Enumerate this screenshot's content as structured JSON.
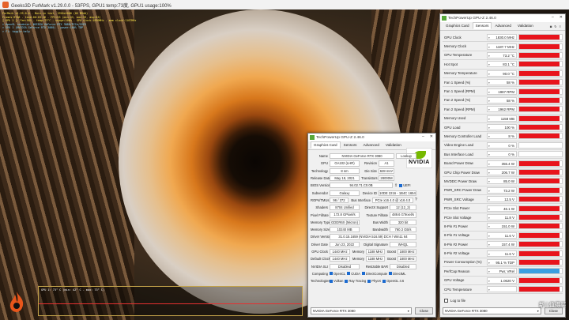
{
  "furmark": {
    "title": "Geeks3D FurMark v1.29.0.0 - 53FPS, GPU1 temp:73度, GPU1 usage:100%",
    "osd": [
      "FurMark v1.29.0.0 - Burn-in test, 1920x1080 (0X MSAA)",
      "Frames:9746 - time:00:03:16 - FPS:53 (min:43, max:59, avg:55)",
      "[ GPU 1 ]: Fan:56% - temp:73°C - usage:100% - GPU clock:1830MHz - mem clock:1187MHz",
      "> OpenGL renderer: NVIDIA GeForce RTX 3080/PCIe/SSE2",
      "> GPU 1 (NVIDIA GeForce RTX 3080) - power:100% TDP",
      "> F1: toggle help"
    ],
    "graph_label": "GPU 1: 73° C (min: 42° C - max: 73° C)"
  },
  "gpuz_sensors": {
    "title": "TechPowerUp GPU-Z 2.46.0",
    "tabs": [
      "Graphics Card",
      "Sensors",
      "Advanced",
      "Validation"
    ],
    "active_tab": "Sensors",
    "rows": [
      {
        "label": "GPU Clock",
        "value": "1830.0 MHz",
        "fill": 0.95
      },
      {
        "label": "Memory Clock",
        "value": "1187.7 MHz",
        "fill": 0.95
      },
      {
        "label": "GPU Temperature",
        "value": "73.2 °C",
        "fill": 0.95
      },
      {
        "label": "Hot Spot",
        "value": "83.1 °C",
        "fill": 0.95
      },
      {
        "label": "Memory Temperature",
        "value": "90.0 °C",
        "fill": 0.95
      },
      {
        "label": "Fan 1 Speed (%)",
        "value": "58 %",
        "fill": 0.95
      },
      {
        "label": "Fan 1 Speed (RPM)",
        "value": "1987 RPM",
        "fill": 0.95
      },
      {
        "label": "Fan 2 Speed (%)",
        "value": "58 %",
        "fill": 0.95
      },
      {
        "label": "Fan 2 Speed (RPM)",
        "value": "1962 RPM",
        "fill": 0.95
      },
      {
        "label": "Memory Used",
        "value": "1158 MB",
        "fill": 0.95
      },
      {
        "label": "GPU Load",
        "value": "100 %",
        "fill": 0.95
      },
      {
        "label": "Memory Controller Load",
        "value": "8 %",
        "fill": 0.95
      },
      {
        "label": "Video Engine Load",
        "value": "0 %",
        "fill": 0
      },
      {
        "label": "Bus Interface Load",
        "value": "0 %",
        "fill": 0
      },
      {
        "label": "Board Power Draw",
        "value": "355.4 W",
        "fill": 0.95
      },
      {
        "label": "GPU Chip Power Draw",
        "value": "206.7 W",
        "fill": 0.95
      },
      {
        "label": "MVDDC Power Draw",
        "value": "85.0 W",
        "fill": 0.95
      },
      {
        "label": "PWR_SRC Power Draw",
        "value": "73.2 W",
        "fill": 0.95
      },
      {
        "label": "PWR_SRC Voltage",
        "value": "12.5 V",
        "fill": 0.95
      },
      {
        "label": "PCIe Slot Power",
        "value": "46.1 W",
        "fill": 0.95
      },
      {
        "label": "PCIe Slot Voltage",
        "value": "11.8 V",
        "fill": 0.95
      },
      {
        "label": "8-Pin #1 Power",
        "value": "151.0 W",
        "fill": 0.95
      },
      {
        "label": "8-Pin #1 Voltage",
        "value": "11.6 V",
        "fill": 0.95
      },
      {
        "label": "8-Pin #2 Power",
        "value": "157.4 W",
        "fill": 0.95
      },
      {
        "label": "8-Pin #2 Voltage",
        "value": "11.6 V",
        "fill": 0.95
      },
      {
        "label": "Power Consumption (%)",
        "value": "95.1 % TDP",
        "fill": 0.95
      },
      {
        "label": "PerfCap Reason",
        "value": "Pwr, VRel",
        "fill": 0.95,
        "blue": true
      },
      {
        "label": "GPU Voltage",
        "value": "1.0620 V",
        "fill": 0.95
      },
      {
        "label": "CPU Temperature",
        "value": "",
        "fill": 0.95
      }
    ],
    "log_label": "Log to file",
    "device": "NVIDIA GeForce RTX 3080",
    "close": "Close"
  },
  "gpuz_card": {
    "title": "TechPowerUp GPU-Z 2.46.0",
    "tabs": [
      "Graphics Card",
      "Sensors",
      "Advanced",
      "Validation"
    ],
    "active_tab": "Graphics Card",
    "name_label": "Name",
    "name": "NVIDIA GeForce RTX 3080",
    "lookup": "Lookup",
    "gpu_label": "GPU",
    "gpu": "GA102 (LHR)",
    "rev_label": "Revision",
    "rev": "A1",
    "tech_label": "Technology",
    "tech": "8 nm",
    "die_label": "Die Size",
    "die": "628 mm²",
    "rel_label": "Release Date",
    "rel": "May 18, 2021",
    "trans_label": "Transistors",
    "trans": "28000M",
    "bios_label": "BIOS Version",
    "bios": "94.02.71.C0.0B",
    "uefi": "UEFI",
    "sub_label": "Subvendor",
    "sub": "Galaxy",
    "devid_label": "Device ID",
    "devid": "10DE 2216 - 1B4C 1654",
    "rops_label": "ROPs/TMUs",
    "rops": "96 / 272",
    "bus_label": "Bus Interface",
    "bus": "PCIe x16 4.0 @ x16 4.0",
    "shaders_label": "Shaders",
    "shaders": "8704 Unified",
    "dx_label": "DirectX Support",
    "dx": "12 (12_2)",
    "pix_label": "Pixel Fillrate",
    "pix": "172.8 GPixel/s",
    "tex_label": "Texture Fillrate",
    "tex": "489.6 GTexel/s",
    "memt_label": "Memory Type",
    "memt": "GDDR6X (Micron)",
    "bw_label": "Bus Width",
    "bw": "320 bit",
    "mems_label": "Memory Size",
    "mems": "10240 MB",
    "band_label": "Bandwidth",
    "band": "760.3 GB/s",
    "drv_label": "Driver Version",
    "drv": "31.0.15.1659 (NVIDIA 516.59) DCH / Win11 64",
    "drvd_label": "Driver Date",
    "drvd": "Jun 23, 2022",
    "sig_label": "Digital Signature",
    "sig": "WHQL",
    "gclk_label": "GPU Clock",
    "gclk": "1440 MHz",
    "mem_label": "Memory",
    "mclk": "1188 MHz",
    "boost_label": "Boost",
    "boost": "1800 MHz",
    "dclk_label": "Default Clock",
    "dclk": "1440 MHz",
    "dmclk": "1188 MHz",
    "dboost": "1800 MHz",
    "sli_label": "NVIDIA SLI",
    "sli": "Disabled",
    "rbar_label": "Resizable BAR",
    "rbar": "Disabled",
    "comp_label": "Computing",
    "computing": [
      "OpenCL",
      "CUDA",
      "DirectCompute",
      "DirectML"
    ],
    "tech2_label": "Technologies",
    "technologies": [
      "Vulkan",
      "Ray Tracing",
      "PhysX",
      "OpenGL 4.6"
    ],
    "device": "NVIDIA GeForce RTX 3080",
    "close": "Close",
    "nvidia": "NVIDIA"
  },
  "watermark": "新 | 值得买"
}
